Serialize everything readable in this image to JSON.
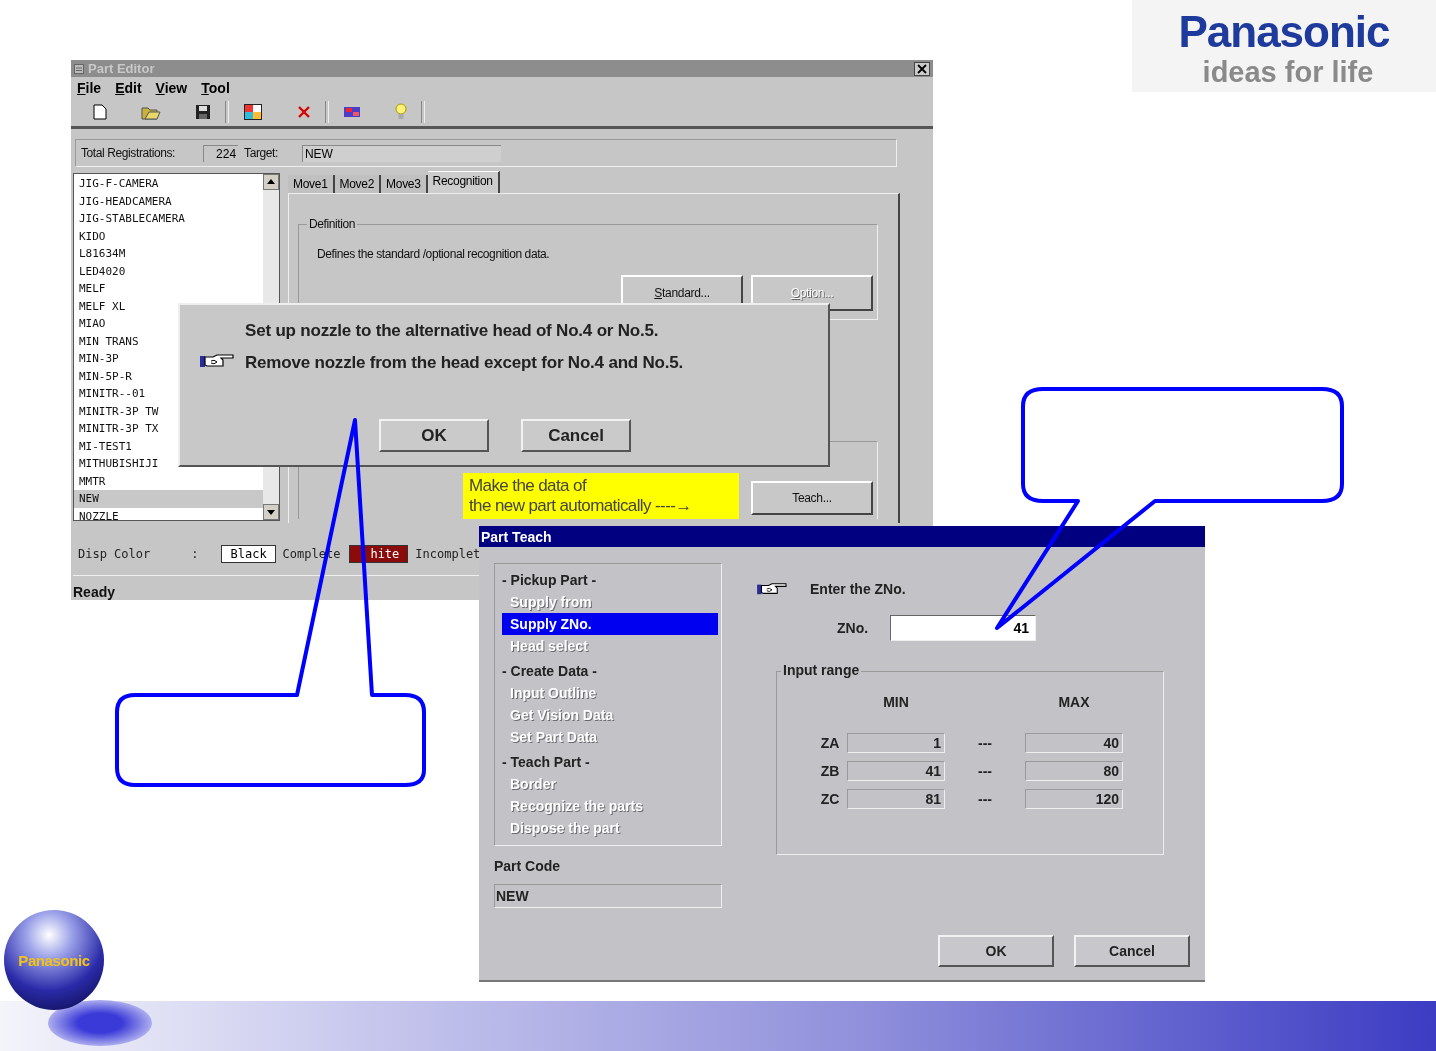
{
  "brand": {
    "name": "Panasonic",
    "slogan": "ideas for life",
    "badge": "Panasonic"
  },
  "part_editor": {
    "title": "Part Editor",
    "menu": [
      "File",
      "Edit",
      "View",
      "Tool"
    ],
    "registrations": {
      "label": "Total Registrations:",
      "value": "224",
      "target_label": "Target:",
      "target_value": "NEW"
    },
    "part_list": [
      {
        "label": "JIG-F-CAMERA",
        "selected": false
      },
      {
        "label": "JIG-HEADCAMERA",
        "selected": false
      },
      {
        "label": "JIG-STABLECAMERA",
        "selected": false
      },
      {
        "label": "KIDO",
        "selected": false
      },
      {
        "label": "L81634M",
        "selected": false
      },
      {
        "label": "LED4020",
        "selected": false
      },
      {
        "label": "MELF",
        "selected": false
      },
      {
        "label": "MELF XL",
        "selected": false
      },
      {
        "label": "MIAO",
        "selected": false
      },
      {
        "label": "MIN TRANS",
        "selected": false
      },
      {
        "label": "MIN-3P",
        "selected": false
      },
      {
        "label": "MIN-5P-R",
        "selected": false
      },
      {
        "label": "MINITR--01",
        "selected": false
      },
      {
        "label": "MINITR-3P TW",
        "selected": false
      },
      {
        "label": "MINITR-3P TX",
        "selected": false
      },
      {
        "label": "MI-TEST1",
        "selected": false
      },
      {
        "label": "MITHUBISHIJI",
        "selected": false
      },
      {
        "label": "MMTR",
        "selected": false
      },
      {
        "label": "NEW",
        "selected": true
      },
      {
        "label": "NOZZLE",
        "selected": false
      }
    ],
    "tabs": [
      {
        "label": "Move1",
        "selected": false
      },
      {
        "label": "Move2",
        "selected": false
      },
      {
        "label": "Move3",
        "selected": false
      },
      {
        "label": "Recognition",
        "selected": true
      }
    ],
    "definition": {
      "legend": "Definition",
      "text": "Defines the standard /optional recognition data.",
      "buttons": [
        {
          "label": "Standard...",
          "disabled": false
        },
        {
          "label": "Option...",
          "disabled": true
        }
      ]
    },
    "note": [
      "Make the data of",
      "the new part automatically ----→"
    ],
    "teach_button": "Teach...",
    "disp_color": {
      "label": "Disp Color",
      "separator": ":",
      "items": [
        {
          "swatch": "Black",
          "color": "#ffffff",
          "text": "Complete"
        },
        {
          "swatch": "hite",
          "color": "#8b0a0a",
          "text": "Incomplet"
        }
      ]
    },
    "status": "Ready"
  },
  "dialog": {
    "lines": [
      "Set up nozzle to the alternative head of No.4 or No.5.",
      "Remove nozzle from the head except for No.4 and No.5."
    ],
    "buttons": [
      "OK",
      "Cancel"
    ]
  },
  "part_teach": {
    "title": "Part Teach",
    "steps": [
      {
        "heading": "- Pickup Part -",
        "items": [
          {
            "label": "Supply from",
            "selected": false
          },
          {
            "label": "Supply ZNo.",
            "selected": true
          },
          {
            "label": "Head select",
            "selected": false
          }
        ]
      },
      {
        "heading": "- Create Data -",
        "items": [
          {
            "label": "Input Outline",
            "selected": false
          },
          {
            "label": "Get Vision Data",
            "selected": false
          },
          {
            "label": "Set Part Data",
            "selected": false
          }
        ]
      },
      {
        "heading": "- Teach Part -",
        "items": [
          {
            "label": "Border",
            "selected": false
          },
          {
            "label": "Recognize the parts",
            "selected": false
          },
          {
            "label": "Dispose the part",
            "selected": false
          }
        ]
      }
    ],
    "part_code": {
      "label": "Part Code",
      "value": "NEW"
    },
    "prompt": "Enter the ZNo.",
    "zno": {
      "label": "ZNo.",
      "value": "41"
    },
    "input_range": {
      "legend": "Input range",
      "min_header": "MIN",
      "max_header": "MAX",
      "rows": [
        {
          "name": "ZA",
          "min": "1",
          "separator": "---",
          "max": "40"
        },
        {
          "name": "ZB",
          "min": "41",
          "separator": "---",
          "max": "80"
        },
        {
          "name": "ZC",
          "min": "81",
          "separator": "---",
          "max": "120"
        }
      ]
    },
    "buttons": [
      "OK",
      "Cancel"
    ]
  }
}
